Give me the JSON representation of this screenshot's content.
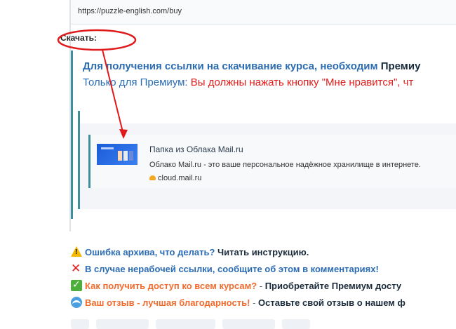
{
  "url_box": {
    "url": "https://puzzle-english.com/buy"
  },
  "download": {
    "label": "Скачать:"
  },
  "info": {
    "line1_blue": "Для получения ссылки на скачивание курса, необходим ",
    "line1_dark": "Премиу",
    "line2_blue": "Только для Премиум: ",
    "line2_red": "Вы должны нажать кнопку \"Мне нравится\", чт"
  },
  "card": {
    "title": "Папка из Облака Mail.ru",
    "description": "Облако Mail.ru - это ваше персональное надёжное хранилище в интернете.",
    "site": "cloud.mail.ru"
  },
  "links": {
    "archive_error": "Ошибка архива, что делать?",
    "archive_instr": " Читать инструкцию.",
    "broken_link": "В случае нерабочей ссылки, сообщите об этом в комментариях!",
    "access_question": "Как получить доступ ко всем курсам?",
    "access_dash": " - ",
    "access_answer": "Приобретайте Премиум досту",
    "review": "Ваш отзыв - лучшая благодарность!",
    "review_dash": " - ",
    "review_action": "Оставьте свой отзыв о нашем ф"
  },
  "icons": {
    "warning": "warning-icon",
    "cross": "cross-icon",
    "check": "check-icon",
    "wave": "wave-icon",
    "cloud": "cloud-icon"
  },
  "colors": {
    "link_blue": "#2b6cb3",
    "alert_red": "#e21b1b",
    "accent_orange": "#f26b2e",
    "quote_border": "#3f8f9a",
    "annotation_red": "#e0191b"
  }
}
